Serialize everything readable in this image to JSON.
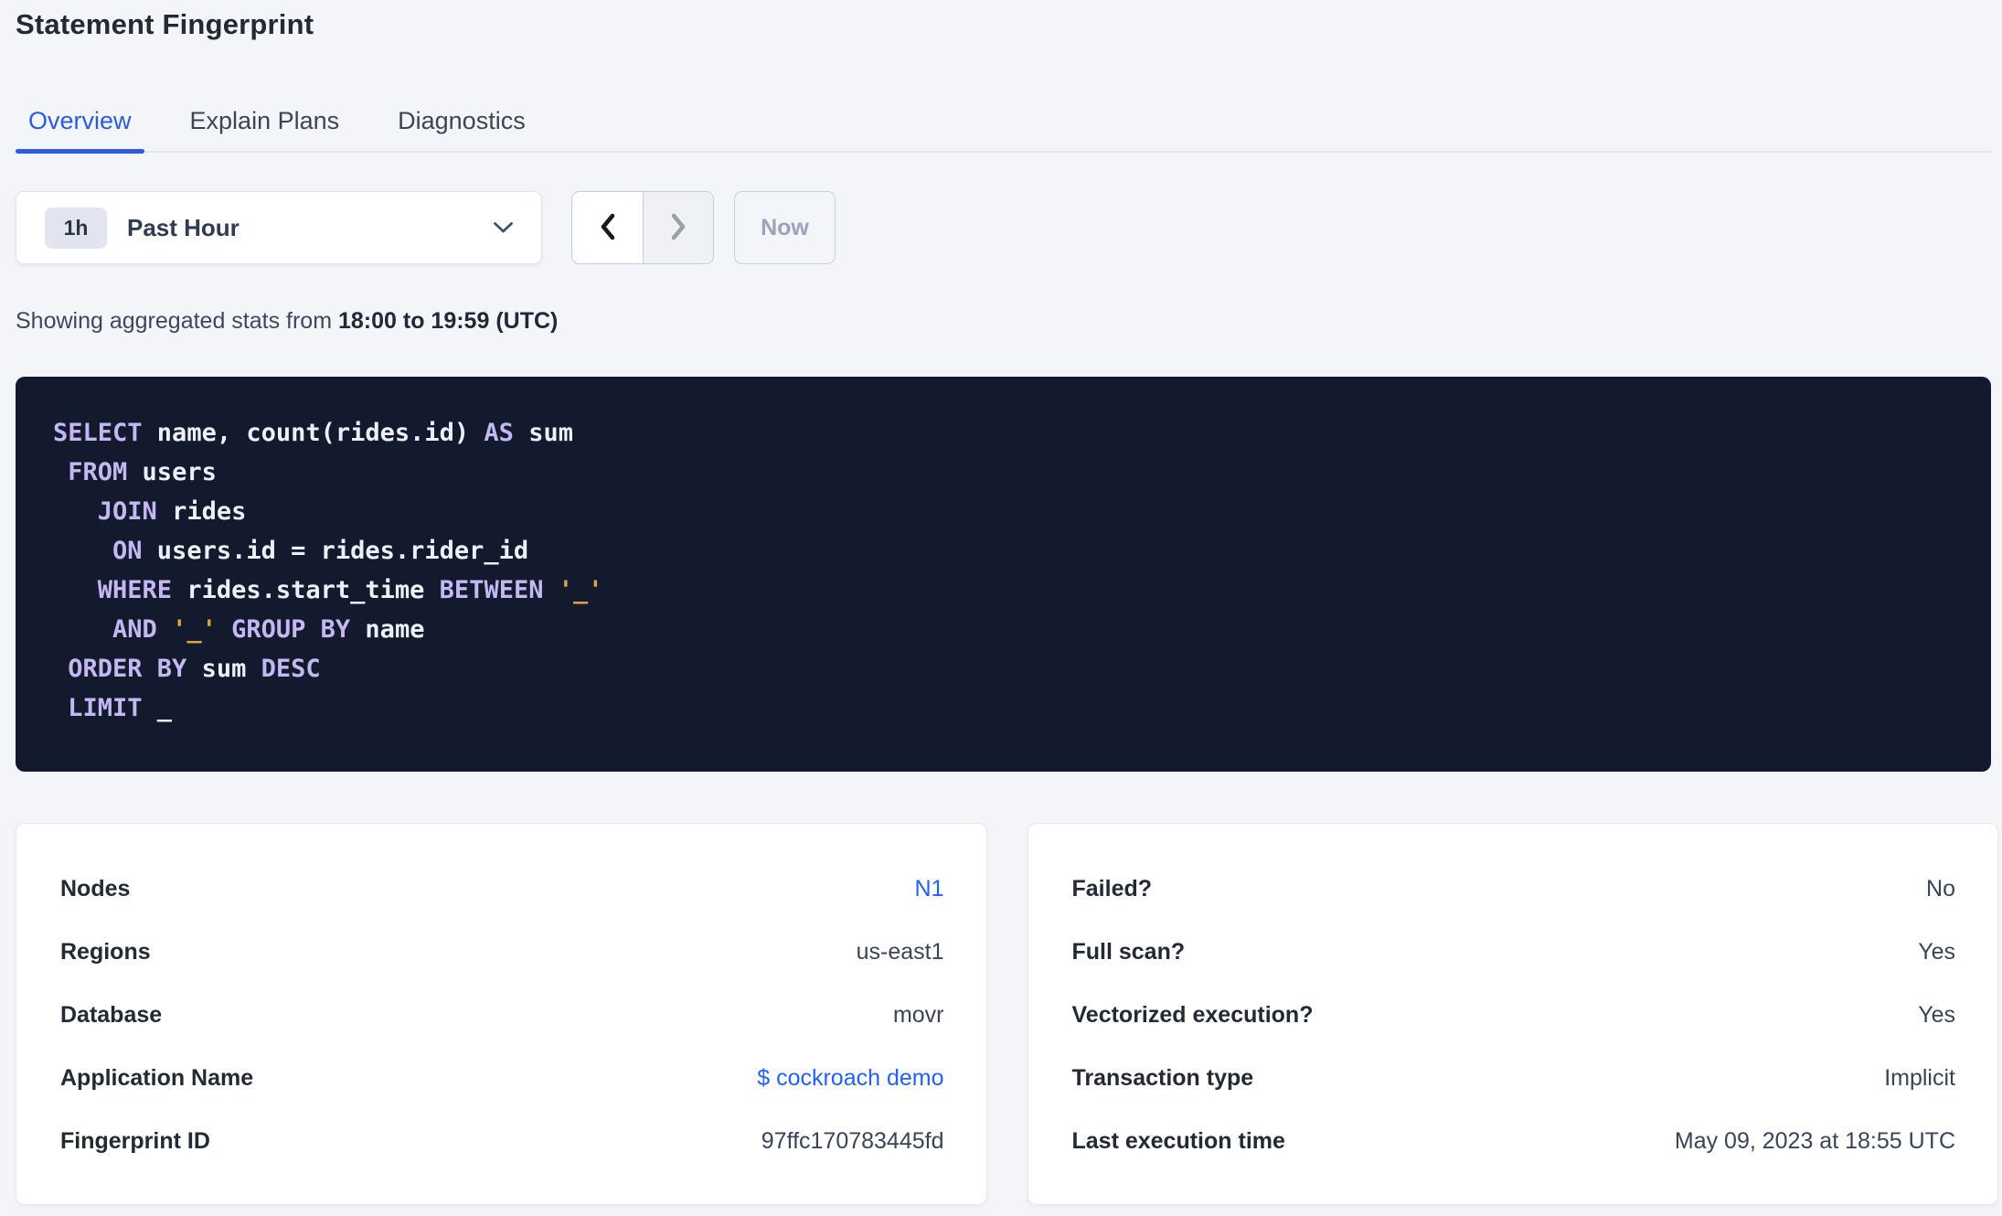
{
  "header": {
    "title": "Statement Fingerprint"
  },
  "tabs": [
    {
      "label": "Overview",
      "active": true
    },
    {
      "label": "Explain Plans",
      "active": false
    },
    {
      "label": "Diagnostics",
      "active": false
    }
  ],
  "time_picker": {
    "badge": "1h",
    "selected": "Past Hour",
    "now_label": "Now",
    "previous_enabled": true,
    "next_enabled": false,
    "now_enabled": false,
    "icons": {
      "dropdown": "chevron-down",
      "previous": "chevron-left",
      "next": "chevron-right"
    }
  },
  "stats_line": {
    "prefix": "Showing aggregated stats from",
    "range": "18:00 to 19:59 (UTC)"
  },
  "sql": {
    "lines": [
      [
        [
          "kw",
          "SELECT"
        ],
        [
          "pl",
          " name, count(rides.id) "
        ],
        [
          "kw",
          "AS"
        ],
        [
          "pl",
          " sum"
        ]
      ],
      [
        [
          "pl",
          " "
        ],
        [
          "kw",
          "FROM"
        ],
        [
          "pl",
          " users"
        ]
      ],
      [
        [
          "pl",
          "   "
        ],
        [
          "kw",
          "JOIN"
        ],
        [
          "pl",
          " rides"
        ]
      ],
      [
        [
          "pl",
          "    "
        ],
        [
          "kw",
          "ON"
        ],
        [
          "pl",
          " users.id = rides.rider_id"
        ]
      ],
      [
        [
          "pl",
          "   "
        ],
        [
          "kw",
          "WHERE"
        ],
        [
          "pl",
          " rides.start_time "
        ],
        [
          "kw",
          "BETWEEN"
        ],
        [
          "pl",
          " "
        ],
        [
          "str",
          "'_'"
        ]
      ],
      [
        [
          "pl",
          "    "
        ],
        [
          "kw",
          "AND"
        ],
        [
          "pl",
          " "
        ],
        [
          "str",
          "'_'"
        ],
        [
          "pl",
          " "
        ],
        [
          "kw",
          "GROUP BY"
        ],
        [
          "pl",
          " name"
        ]
      ],
      [
        [
          "pl",
          " "
        ],
        [
          "kw",
          "ORDER BY"
        ],
        [
          "pl",
          " sum "
        ],
        [
          "kw",
          "DESC"
        ]
      ],
      [
        [
          "pl",
          " "
        ],
        [
          "kw",
          "LIMIT"
        ],
        [
          "pl",
          " _"
        ]
      ]
    ]
  },
  "cards": [
    {
      "name": "statement-details",
      "rows": [
        {
          "label": "Nodes",
          "value": "N1",
          "link": true
        },
        {
          "label": "Regions",
          "value": "us-east1",
          "link": false
        },
        {
          "label": "Database",
          "value": "movr",
          "link": false
        },
        {
          "label": "Application Name",
          "value": "$ cockroach demo",
          "link": true
        },
        {
          "label": "Fingerprint ID",
          "value": "97ffc170783445fd",
          "link": false
        }
      ]
    },
    {
      "name": "execution-attributes",
      "rows": [
        {
          "label": "Failed?",
          "value": "No",
          "link": false
        },
        {
          "label": "Full scan?",
          "value": "Yes",
          "link": false
        },
        {
          "label": "Vectorized execution?",
          "value": "Yes",
          "link": false
        },
        {
          "label": "Transaction type",
          "value": "Implicit",
          "link": false
        },
        {
          "label": "Last execution time",
          "value": "May 09, 2023 at 18:55 UTC",
          "link": false
        }
      ]
    }
  ],
  "colors": {
    "page_bg": "#f4f5f8",
    "accent_link_blue": "#2161fd",
    "active_tab_blue": "#2a5be2",
    "code_bg": "#141a2e",
    "code_keyword": "#c4b8f2",
    "code_plain": "#eef0f7",
    "code_string": "#e0a145",
    "interval_badge_bg": "#e2e5f0"
  }
}
